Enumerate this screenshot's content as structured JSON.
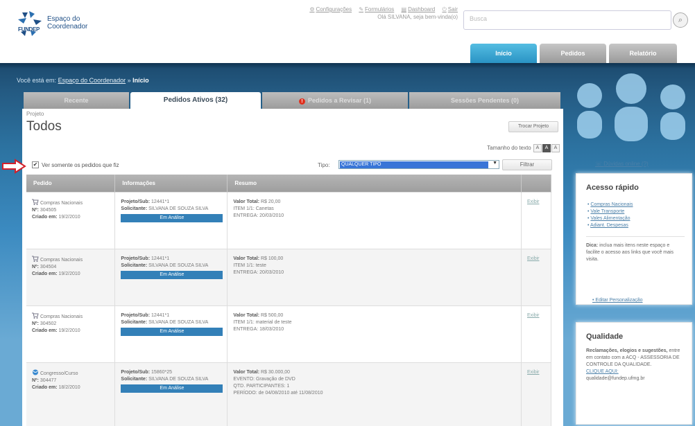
{
  "header": {
    "logo_text": "FUNDEP",
    "app_title": "Espaço do Coordenador",
    "links": [
      "Configurações",
      "Formulários",
      "Dashboard",
      "Sair"
    ],
    "user_line": "Olá SILVANA, seja bem-vinda(o)",
    "search_placeholder": "Busca",
    "nav": {
      "inicio": "Início",
      "pedidos": "Pedidos",
      "relatorio": "Relatório"
    }
  },
  "breadcrumb": {
    "prefix": "Você está em:",
    "parent": "Espaço do Coordenador",
    "separator": " » ",
    "current": "Início"
  },
  "tabs": {
    "recente": "Recente",
    "ativos": "Pedidos Ativos (32)",
    "revisar": "Pedidos a Revisar (1)",
    "sessoes": "Sessões Pendentes (0)"
  },
  "project": {
    "label": "Projeto",
    "title": "Todos",
    "change_button": "Trocar Projeto"
  },
  "text_size": {
    "label": "Tamanho do texto",
    "options": [
      "A",
      "A",
      "A"
    ]
  },
  "filter": {
    "checkbox_label": "Ver somente os pedidos que fiz",
    "checked": true,
    "type_label": "Tipo:",
    "type_value": "QUALQUER TIPO",
    "filter_button": "Filtrar"
  },
  "table": {
    "headers": [
      "Pedido",
      "Informações",
      "Resumo",
      ""
    ],
    "rows": [
      {
        "tipo": "Compras Nacionais",
        "num_label": "Nº:",
        "num": "304505",
        "created_label": "Criado em:",
        "created": "19/2/2010",
        "proj_label": "Projeto/Sub:",
        "proj": "12441*1",
        "sol_label": "Solicitante:",
        "sol": "SILVANA DE SOUZA SILVA",
        "status": "Em Análise",
        "line1_label": "Valor Total:",
        "line1": "R$ 20,00",
        "line2": "ITEM 1/1: Canetas",
        "line3": "ENTREGA: 20/03/2010",
        "line4": "",
        "action": "Exibir"
      },
      {
        "tipo": "Compras Nacionais",
        "num_label": "Nº:",
        "num": "304504",
        "created_label": "Criado em:",
        "created": "19/2/2010",
        "proj_label": "Projeto/Sub:",
        "proj": "12441*1",
        "sol_label": "Solicitante:",
        "sol": "SILVANA DE SOUZA SILVA",
        "status": "Em Análise",
        "line1_label": "Valor Total:",
        "line1": "R$ 100,00",
        "line2": "ITEM 1/1: teste",
        "line3": "ENTREGA: 20/03/2010",
        "line4": "",
        "action": "Exibir"
      },
      {
        "tipo": "Compras Nacionais",
        "num_label": "Nº:",
        "num": "304502",
        "created_label": "Criado em:",
        "created": "19/2/2010",
        "proj_label": "Projeto/Sub:",
        "proj": "12441*1",
        "sol_label": "Solicitante:",
        "sol": "SILVANA DE SOUZA SILVA",
        "status": "Em Análise",
        "line1_label": "Valor Total:",
        "line1": "R$ 500,00",
        "line2": "ITEM 1/1: material de teste",
        "line3": "ENTREGA: 18/03/2010",
        "line4": "",
        "action": "Exibir"
      },
      {
        "tipo": "Congresso/Curso",
        "num_label": "Nº:",
        "num": "304477",
        "created_label": "Criado em:",
        "created": "18/2/2010",
        "proj_label": "Projeto/Sub:",
        "proj": "15860*25",
        "sol_label": "Solicitante:",
        "sol": "SILVANA DE SOUZA SILVA",
        "status": "Em Análise",
        "line1_label": "Valor Total:",
        "line1": "R$ 30.000,00",
        "line2": "EVENTO: Gravação de DVD",
        "line3": "QTD. PARTICIPANTES: 1",
        "line4": "PERÍODO: de 04/08/2010 até 11/08/2010",
        "action": "Exibir"
      }
    ]
  },
  "sidebar": {
    "help": "Dúvidas online (?)",
    "quick": {
      "title": "Acesso rápido",
      "links": [
        "Compras Nacionais",
        "Vale Transporte",
        "Vales Alimentação",
        "Adiant. Despesas"
      ],
      "tip_label": "Dica:",
      "tip": "inclua mais itens neste espaço e facilite o acesso aos links que você mais visita."
    },
    "edit": "Editar Personalização",
    "quality": {
      "title": "Qualidade",
      "bold": "Reclamações, elogios e sugestões,",
      "text": "entre em contato com a ACQ - ASSESSORIA DE CONTROLE DA QUALIDADE.",
      "link": "CLIQUE AQUI:",
      "email": "qualidade@fundep.ufmg.br"
    }
  },
  "colors": {
    "accent": "#3380b8",
    "band_top": "#1c4a6e",
    "arrow": "#d4202a"
  }
}
